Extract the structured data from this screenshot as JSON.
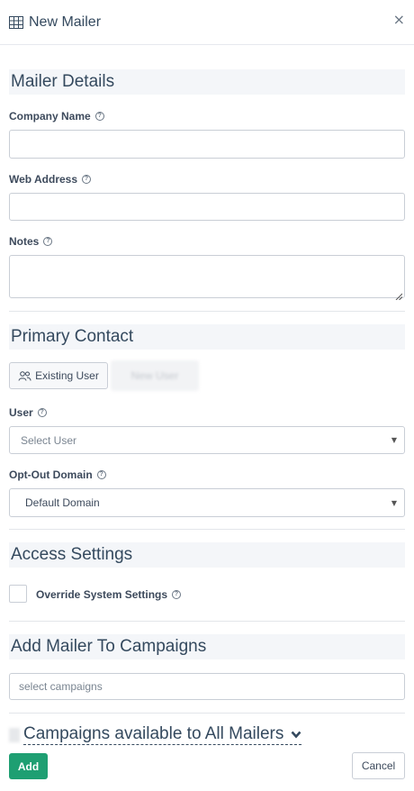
{
  "header": {
    "title": "New Mailer",
    "icon": "grid-icon",
    "close_label": "×"
  },
  "mailer_details": {
    "heading": "Mailer Details",
    "company_name": {
      "label": "Company Name",
      "value": ""
    },
    "web_address": {
      "label": "Web Address",
      "value": ""
    },
    "notes": {
      "label": "Notes",
      "value": ""
    }
  },
  "primary_contact": {
    "heading": "Primary Contact",
    "existing_user_label": "Existing User",
    "new_user_label": "New User",
    "user": {
      "label": "User",
      "placeholder": "Select User"
    },
    "opt_out_domain": {
      "label": "Opt-Out Domain",
      "value": "Default Domain"
    }
  },
  "access_settings": {
    "heading": "Access Settings",
    "override_label": "Override System Settings",
    "override_checked": false
  },
  "add_to_campaigns": {
    "heading": "Add Mailer To Campaigns",
    "placeholder": "select campaigns"
  },
  "campaigns_available": {
    "label": "Campaigns available to All Mailers"
  },
  "footer": {
    "add_label": "Add",
    "cancel_label": "Cancel"
  },
  "colors": {
    "primary": "#1e9f72",
    "section_bg": "#f4f6f9",
    "text": "#34495e"
  }
}
